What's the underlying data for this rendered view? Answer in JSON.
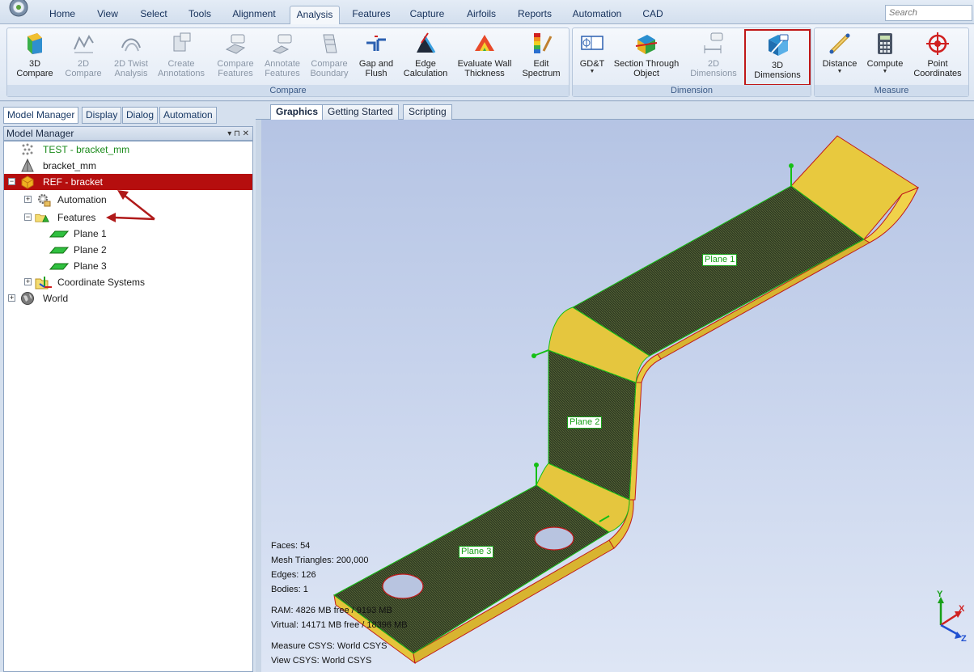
{
  "ribbon_tabs": [
    "Home",
    "View",
    "Select",
    "Tools",
    "Alignment",
    "Analysis",
    "Features",
    "Capture",
    "Airfoils",
    "Reports",
    "Automation",
    "CAD"
  ],
  "active_tab": "Analysis",
  "search": {
    "placeholder": "Search"
  },
  "groups": {
    "compare": {
      "label": "Compare",
      "buttons": [
        {
          "label": "3D\nCompare",
          "icon": "3d-compare-icon"
        },
        {
          "label": "2D\nCompare",
          "icon": "2d-compare-icon"
        },
        {
          "label": "2D Twist\nAnalysis",
          "icon": "2d-twist-icon"
        },
        {
          "label": "Create\nAnnotations",
          "icon": "create-annotations-icon"
        },
        {
          "label": "Compare\nFeatures",
          "icon": "compare-features-icon"
        },
        {
          "label": "Annotate\nFeatures",
          "icon": "annotate-features-icon"
        },
        {
          "label": "Compare\nBoundary",
          "icon": "compare-boundary-icon"
        },
        {
          "label": "Gap and\nFlush",
          "icon": "gap-flush-icon"
        },
        {
          "label": "Edge\nCalculation",
          "icon": "edge-calculation-icon"
        },
        {
          "label": "Evaluate Wall\nThickness",
          "icon": "wall-thickness-icon"
        },
        {
          "label": "Edit\nSpectrum",
          "icon": "edit-spectrum-icon"
        }
      ]
    },
    "dimension": {
      "label": "Dimension",
      "buttons": [
        {
          "label": "GD&T",
          "icon": "gdt-icon"
        },
        {
          "label": "Section Through\nObject",
          "icon": "section-icon"
        },
        {
          "label": "2D\nDimensions",
          "icon": "2d-dimensions-icon"
        },
        {
          "label": "3D\nDimensions",
          "icon": "3d-dimensions-icon"
        }
      ]
    },
    "measure": {
      "label": "Measure",
      "buttons": [
        {
          "label": "Distance",
          "icon": "distance-icon"
        },
        {
          "label": "Compute",
          "icon": "calculator-icon"
        },
        {
          "label": "Point\nCoordinates",
          "icon": "target-icon"
        }
      ]
    }
  },
  "panel_tabs": [
    "Model Manager",
    "Display",
    "Dialog",
    "Automation"
  ],
  "panel_title": "Model Manager",
  "panel_controls": "▾ ⊓ ✕",
  "tree": {
    "test": "TEST - bracket_mm",
    "bracket": "bracket_mm",
    "ref": "REF - bracket",
    "automation": "Automation",
    "features": "Features",
    "plane1": "Plane 1",
    "plane2": "Plane 2",
    "plane3": "Plane 3",
    "csys": "Coordinate Systems",
    "world": "World"
  },
  "graphics_tabs": [
    "Graphics",
    "Getting Started",
    "Scripting"
  ],
  "viewport": {
    "labels": {
      "plane1": "Plane 1",
      "plane2": "Plane 2",
      "plane3": "Plane 3"
    },
    "axes": {
      "x": "X",
      "y": "Y",
      "z": "Z"
    }
  },
  "stats": {
    "faces": "Faces: 54",
    "triangles": "Mesh Triangles: 200,000",
    "edges": "Edges: 126",
    "bodies": "Bodies: 1",
    "ram": "RAM: 4826 MB free / 9193 MB",
    "virtual": "Virtual: 14171 MB free / 18396 MB",
    "measure_csys": "Measure CSYS: World CSYS",
    "view_csys": "View CSYS: World CSYS"
  },
  "colors": {
    "accent_red": "#b50e0e",
    "part_face": "#3a4a2e",
    "part_edge": "#e0c23c",
    "feature_green": "#15c015"
  }
}
